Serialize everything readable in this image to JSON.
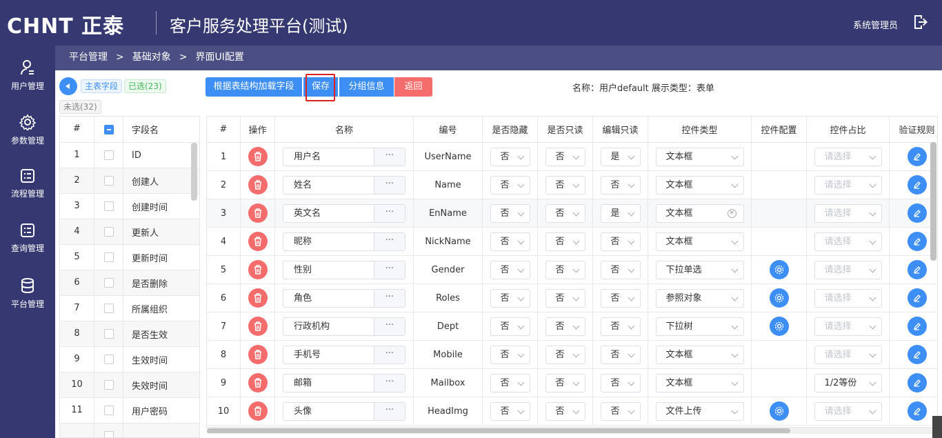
{
  "header": {
    "logo": "CHNT 正泰",
    "title": "客户服务处理平台(测试)",
    "user": "系统管理员"
  },
  "sidebar": {
    "items": [
      {
        "label": "用户管理",
        "icon": "user-icon"
      },
      {
        "label": "参数管理",
        "icon": "gear-icon"
      },
      {
        "label": "流程管理",
        "icon": "list-icon"
      },
      {
        "label": "查询管理",
        "icon": "list-icon"
      },
      {
        "label": "平台管理",
        "icon": "database-icon"
      }
    ]
  },
  "breadcrumb": [
    "平台管理",
    "基础对象",
    "界面UI配置"
  ],
  "left": {
    "tag_main": "主表字段",
    "tag_selected": "已选(23)",
    "tag_unselected": "未选(32)",
    "headers": [
      "#",
      "",
      "字段名"
    ],
    "rows": [
      {
        "n": "1",
        "name": "ID"
      },
      {
        "n": "2",
        "name": "创建人"
      },
      {
        "n": "3",
        "name": "创建时间"
      },
      {
        "n": "4",
        "name": "更新人"
      },
      {
        "n": "5",
        "name": "更新时间"
      },
      {
        "n": "6",
        "name": "是否删除"
      },
      {
        "n": "7",
        "name": "所属组织"
      },
      {
        "n": "8",
        "name": "是否生效"
      },
      {
        "n": "9",
        "name": "生效时间"
      },
      {
        "n": "10",
        "name": "失效时间"
      },
      {
        "n": "11",
        "name": "用户密码"
      }
    ]
  },
  "toolbar": {
    "load": "根据表结构加载字段",
    "save": "保存",
    "group": "分组信息",
    "back": "返回",
    "info": "名称：用户default 展示类型：表单"
  },
  "table": {
    "headers": [
      "#",
      "操作",
      "名称",
      "编号",
      "是否隐藏",
      "是否只读",
      "编辑只读",
      "控件类型",
      "控件配置",
      "控件占比",
      "验证规则"
    ],
    "more": "···",
    "placeholder": "请选择",
    "rows": [
      {
        "n": "1",
        "name": "用户名",
        "code": "UserName",
        "hidden": "否",
        "readonly": "否",
        "editro": "是",
        "ctype": "文本框",
        "cfg": false,
        "ratio": ""
      },
      {
        "n": "2",
        "name": "姓名",
        "code": "Name",
        "hidden": "否",
        "readonly": "否",
        "editro": "否",
        "ctype": "文本框",
        "cfg": false,
        "ratio": ""
      },
      {
        "n": "3",
        "name": "英文名",
        "code": "EnName",
        "hidden": "否",
        "readonly": "否",
        "editro": "是",
        "ctype": "文本框",
        "cfg": false,
        "ratio": "",
        "clear": true
      },
      {
        "n": "4",
        "name": "昵称",
        "code": "NickName",
        "hidden": "否",
        "readonly": "否",
        "editro": "否",
        "ctype": "文本框",
        "cfg": false,
        "ratio": ""
      },
      {
        "n": "5",
        "name": "性别",
        "code": "Gender",
        "hidden": "否",
        "readonly": "否",
        "editro": "否",
        "ctype": "下拉单选",
        "cfg": true,
        "ratio": ""
      },
      {
        "n": "6",
        "name": "角色",
        "code": "Roles",
        "hidden": "否",
        "readonly": "否",
        "editro": "否",
        "ctype": "参照对象",
        "cfg": true,
        "ratio": ""
      },
      {
        "n": "7",
        "name": "行政机构",
        "code": "Dept",
        "hidden": "否",
        "readonly": "否",
        "editro": "否",
        "ctype": "下拉树",
        "cfg": true,
        "ratio": ""
      },
      {
        "n": "8",
        "name": "手机号",
        "code": "Mobile",
        "hidden": "否",
        "readonly": "否",
        "editro": "否",
        "ctype": "文本框",
        "cfg": false,
        "ratio": ""
      },
      {
        "n": "9",
        "name": "邮箱",
        "code": "Mailbox",
        "hidden": "否",
        "readonly": "否",
        "editro": "否",
        "ctype": "文本框",
        "cfg": false,
        "ratio": "1/2等份"
      },
      {
        "n": "10",
        "name": "头像",
        "code": "HeadImg",
        "hidden": "否",
        "readonly": "否",
        "editro": "否",
        "ctype": "文件上传",
        "cfg": true,
        "ratio": ""
      }
    ]
  },
  "colors": {
    "header": "#353871",
    "primary": "#3d8ef5",
    "danger": "#f56c6c"
  }
}
